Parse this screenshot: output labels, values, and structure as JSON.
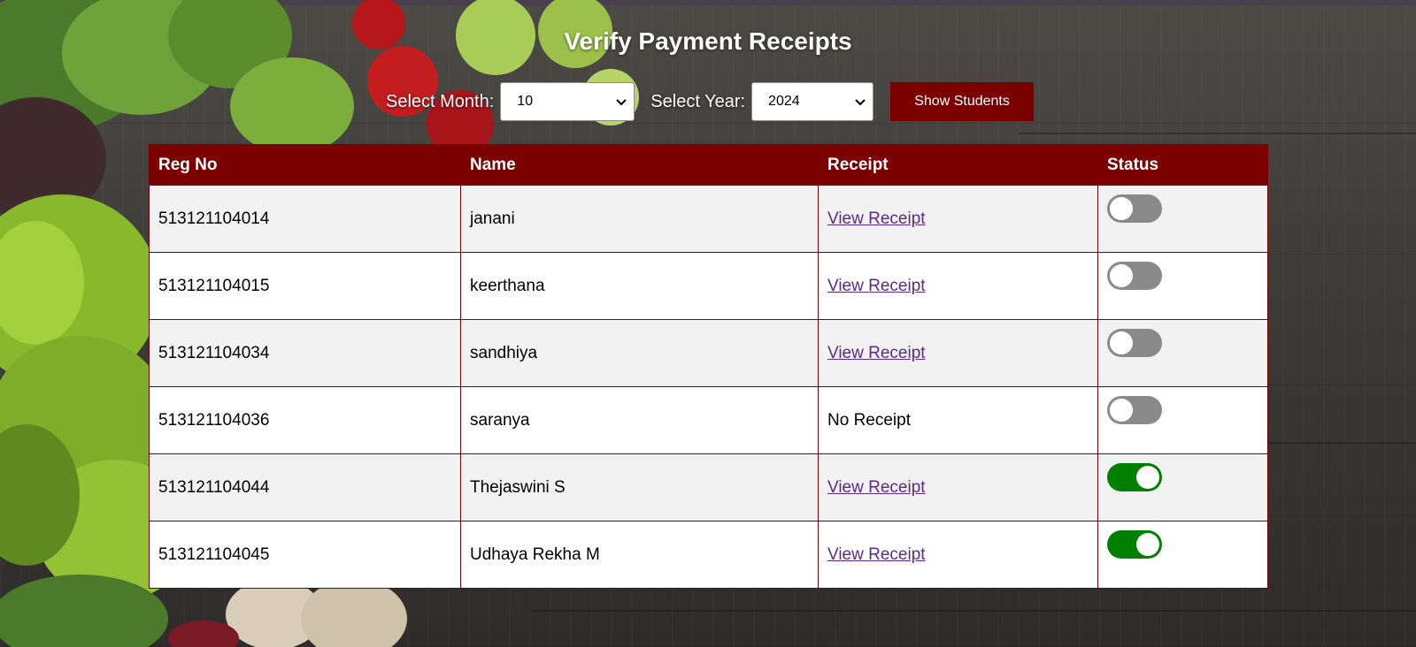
{
  "page": {
    "title": "Verify Payment Receipts"
  },
  "filters": {
    "month_label": "Select Month:",
    "month_value": "10",
    "year_label": "Select Year:",
    "year_value": "2024",
    "show_button": "Show Students"
  },
  "table": {
    "headers": [
      "Reg No",
      "Name",
      "Receipt",
      "Status"
    ],
    "rows": [
      {
        "reg_no": "513121104014",
        "name": "janani",
        "receipt": "View Receipt",
        "has_receipt": true,
        "verified": false
      },
      {
        "reg_no": "513121104015",
        "name": "keerthana",
        "receipt": "View Receipt",
        "has_receipt": true,
        "verified": false
      },
      {
        "reg_no": "513121104034",
        "name": "sandhiya",
        "receipt": "View Receipt",
        "has_receipt": true,
        "verified": false
      },
      {
        "reg_no": "513121104036",
        "name": "saranya",
        "receipt": "No Receipt",
        "has_receipt": false,
        "verified": false
      },
      {
        "reg_no": "513121104044",
        "name": "Thejaswini S",
        "receipt": "View Receipt",
        "has_receipt": true,
        "verified": true
      },
      {
        "reg_no": "513121104045",
        "name": "Udhaya Rekha M",
        "receipt": "View Receipt",
        "has_receipt": true,
        "verified": true
      }
    ]
  },
  "colors": {
    "accent": "#7d0000",
    "toggle_on": "#008000",
    "toggle_off": "#8a8a8a",
    "link": "#5b2a86"
  },
  "icons": {
    "select_arrow": "chevron-down-icon",
    "background": "vegetables-background-image"
  }
}
